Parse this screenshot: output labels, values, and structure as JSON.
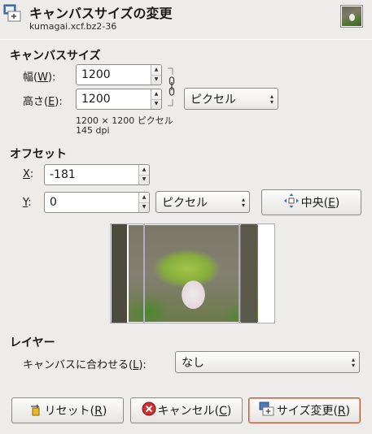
{
  "header": {
    "title": "キャンバスサイズの変更",
    "subtitle": "kumagai.xcf.bz2-36"
  },
  "canvas_size": {
    "section_label": "キャンバスサイズ",
    "width_label_pre": "幅(",
    "width_label_key": "W",
    "width_label_post": "):",
    "width_value": "1200",
    "height_label_pre": "高さ(",
    "height_label_key": "E",
    "height_label_post": "):",
    "height_value": "1200",
    "unit": "ピクセル",
    "size_info": "1200 × 1200 ピクセル",
    "dpi_info": "145 dpi"
  },
  "offset": {
    "section_label": "オフセット",
    "x_label_key": "X",
    "x_label_post": ":",
    "x_value": "-181",
    "y_label_key": "Y",
    "y_label_post": ":",
    "y_value": "0",
    "unit": "ピクセル",
    "center_pre": "中央(",
    "center_key": "E",
    "center_post": ")"
  },
  "layers": {
    "section_label": "レイヤー",
    "fit_label_pre": "キャンバスに合わせる(",
    "fit_label_key": "L",
    "fit_label_post": "):",
    "fit_value": "なし"
  },
  "buttons": {
    "reset_pre": "リセット(",
    "reset_key": "R",
    "reset_post": ")",
    "cancel_pre": "キャンセル(",
    "cancel_key": "C",
    "cancel_post": ")",
    "resize_pre": "サイズ変更(",
    "resize_key": "R",
    "resize_post": ")"
  },
  "colors": {
    "background": "#edeceb",
    "cancel_icon": "#d42d2d",
    "reset_icon": "#e8b72a",
    "default_button_border": "#c1563a"
  }
}
